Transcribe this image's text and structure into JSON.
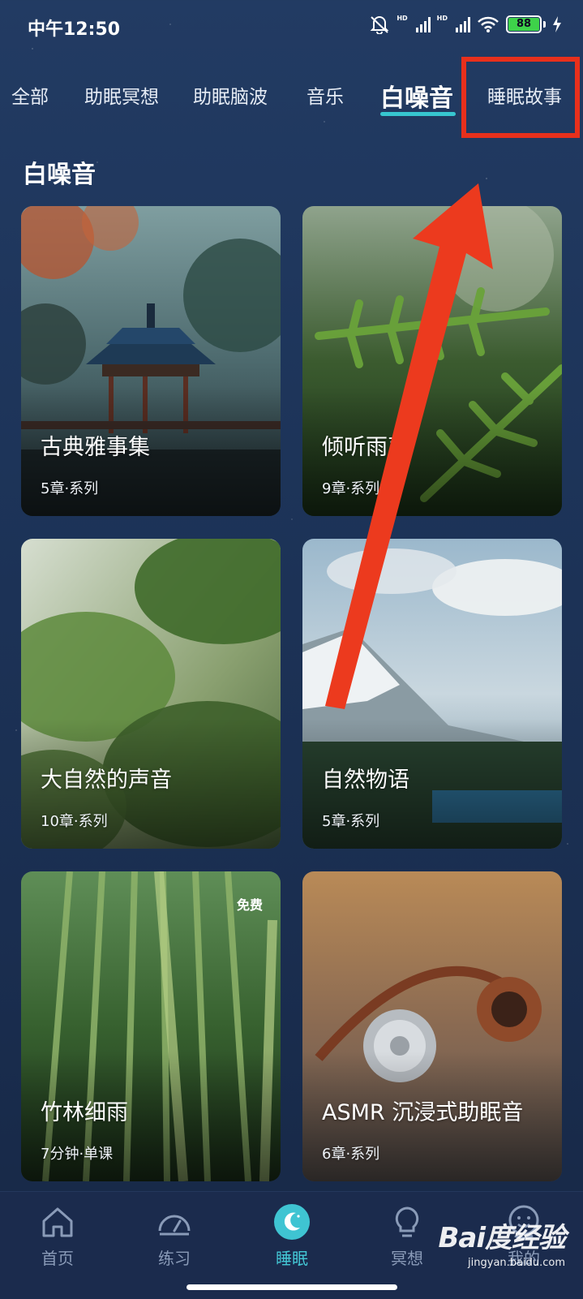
{
  "status_bar": {
    "time": "中午12:50",
    "battery": "88",
    "hd1": "HD",
    "hd2": "HD"
  },
  "tabs": [
    {
      "label": "全部"
    },
    {
      "label": "助眠冥想"
    },
    {
      "label": "助眠脑波"
    },
    {
      "label": "音乐"
    },
    {
      "label": "白噪音",
      "active": true
    },
    {
      "label": "睡眠故事"
    }
  ],
  "section": {
    "title": "白噪音"
  },
  "cards": [
    {
      "title": "古典雅事集",
      "meta": "5章·系列"
    },
    {
      "title": "倾听雨声",
      "meta": "9章·系列"
    },
    {
      "title": "大自然的声音",
      "meta": "10章·系列"
    },
    {
      "title": "自然物语",
      "meta": "5章·系列"
    },
    {
      "title": "竹林细雨",
      "meta": "7分钟·单课",
      "badge": "免费"
    },
    {
      "title": "ASMR 沉浸式助眠音",
      "meta": "6章·系列"
    }
  ],
  "bottom_nav": [
    {
      "label": "首页",
      "icon": "home-icon"
    },
    {
      "label": "练习",
      "icon": "gauge-icon"
    },
    {
      "label": "睡眠",
      "icon": "moon-icon",
      "active": true
    },
    {
      "label": "冥想",
      "icon": "lightbulb-icon"
    },
    {
      "label": "我的",
      "icon": "profile-icon"
    }
  ],
  "watermark": {
    "logo": "Bai度经验",
    "url": "jingyan.baidu.com"
  },
  "colors": {
    "accent": "#37c6d0",
    "annotation_red": "#e8301c",
    "background": "#1d3459"
  }
}
